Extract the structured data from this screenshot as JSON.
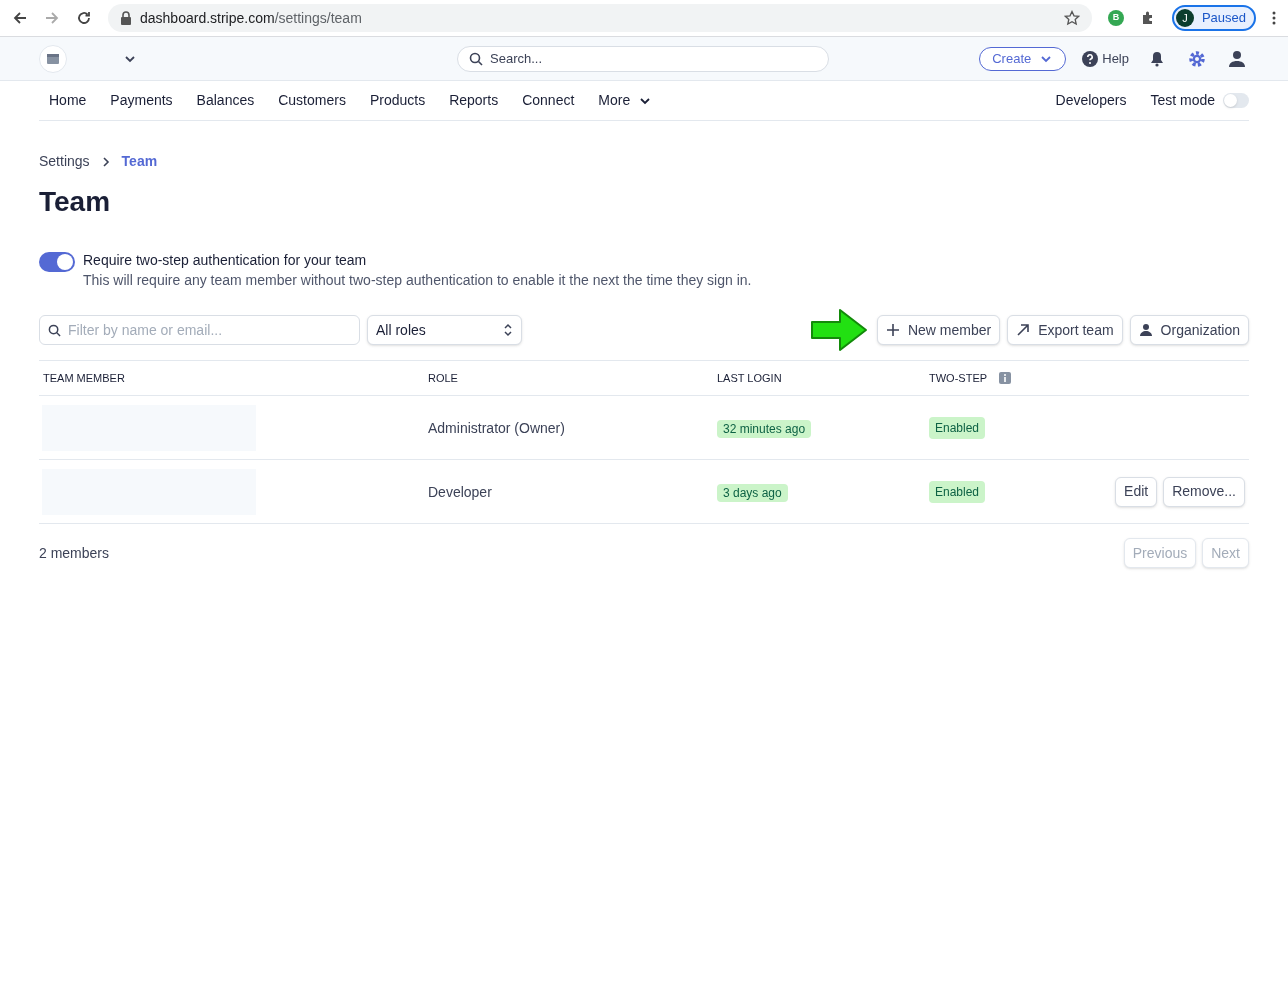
{
  "browser": {
    "url_host": "dashboard.stripe.com",
    "url_path": "/settings/team",
    "extension_badge": "B",
    "profile_initial": "J",
    "profile_status": "Paused"
  },
  "header": {
    "search": {
      "placeholder": "Search..."
    },
    "create_button": "Create",
    "help": "Help"
  },
  "nav": {
    "items": [
      {
        "label": "Home"
      },
      {
        "label": "Payments"
      },
      {
        "label": "Balances"
      },
      {
        "label": "Customers"
      },
      {
        "label": "Products"
      },
      {
        "label": "Reports"
      },
      {
        "label": "Connect"
      },
      {
        "label": "More",
        "dropdown": true
      }
    ],
    "developers": "Developers",
    "test_mode": {
      "label": "Test mode",
      "on": false
    }
  },
  "breadcrumb": [
    {
      "label": "Settings",
      "current": false
    },
    {
      "label": "Team",
      "current": true
    }
  ],
  "title": "Team",
  "two_step": {
    "on": true,
    "label": "Require two-step authentication for your team",
    "description": "This will require any team member without two-step authentication to enable it the next the time they sign in."
  },
  "filter": {
    "placeholder": "Filter by name or email..."
  },
  "role_select": {
    "value": "All roles"
  },
  "actions": [
    {
      "kind": "add",
      "label": "New member"
    },
    {
      "kind": "export",
      "label": "Export team"
    },
    {
      "kind": "person",
      "label": "Organization"
    }
  ],
  "table": {
    "columns": [
      "TEAM MEMBER",
      "ROLE",
      "LAST LOGIN",
      "TWO-STEP"
    ],
    "rows": [
      {
        "role": "Administrator (Owner)",
        "last_login": "32 minutes ago",
        "two_step": "Enabled",
        "actions": []
      },
      {
        "role": "Developer",
        "last_login": "3 days ago",
        "two_step": "Enabled",
        "actions": [
          "Edit",
          "Remove..."
        ]
      }
    ]
  },
  "footer": {
    "count": "2 members",
    "previous": {
      "label": "Previous",
      "disabled": true
    },
    "next": {
      "label": "Next",
      "disabled": true
    }
  }
}
